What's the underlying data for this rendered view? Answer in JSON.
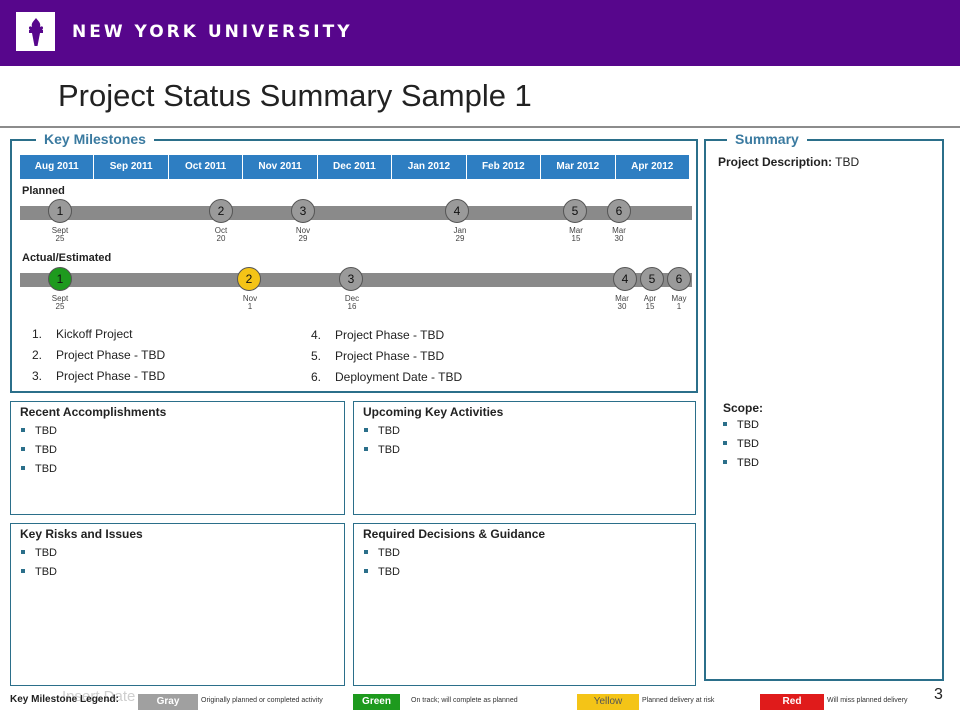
{
  "header": {
    "brand": "NEW YORK UNIVERSITY",
    "logo_icon": "torch-icon",
    "color": "#57068c"
  },
  "title": "Project Status Summary Sample 1",
  "milestones": {
    "label": "Key Milestones",
    "months": [
      "Aug 2011",
      "Sep 2011",
      "Oct 2011",
      "Nov 2011",
      "Dec 2011",
      "Jan 2012",
      "Feb 2012",
      "Mar 2012",
      "Apr 2012"
    ],
    "planned_label": "Planned",
    "actual_label": "Actual/Estimated",
    "planned": [
      {
        "n": "1",
        "date1": "Sept",
        "date2": "25",
        "status": "gray"
      },
      {
        "n": "2",
        "date1": "Oct",
        "date2": "20",
        "status": "gray"
      },
      {
        "n": "3",
        "date1": "Nov",
        "date2": "29",
        "status": "gray"
      },
      {
        "n": "4",
        "date1": "Jan",
        "date2": "29",
        "status": "gray"
      },
      {
        "n": "5",
        "date1": "Mar",
        "date2": "15",
        "status": "gray"
      },
      {
        "n": "6",
        "date1": "Mar",
        "date2": "30",
        "status": "gray"
      }
    ],
    "actual": [
      {
        "n": "1",
        "date1": "Sept",
        "date2": "25",
        "status": "green"
      },
      {
        "n": "2",
        "date1": "Nov",
        "date2": "1",
        "status": "yellow"
      },
      {
        "n": "3",
        "date1": "Dec",
        "date2": "16",
        "status": "gray"
      },
      {
        "n": "4",
        "date1": "Mar",
        "date2": "30",
        "status": "gray"
      },
      {
        "n": "5",
        "date1": "Apr",
        "date2": "15",
        "status": "gray"
      },
      {
        "n": "6",
        "date1": "May",
        "date2": "1",
        "status": "gray"
      }
    ],
    "list_left": [
      {
        "num": "1.",
        "text": "Kickoff Project"
      },
      {
        "num": "2.",
        "text": "Project Phase - TBD"
      },
      {
        "num": "3.",
        "text": "Project Phase - TBD"
      }
    ],
    "list_right": [
      {
        "num": "4.",
        "text": "Project Phase - TBD"
      },
      {
        "num": "5.",
        "text": "Project Phase - TBD"
      },
      {
        "num": "6.",
        "text": "Deployment Date - TBD"
      }
    ]
  },
  "summary": {
    "label": "Summary",
    "description_label": "Project Description:",
    "description_value": " TBD",
    "scope_label": "Scope:",
    "scope_items": [
      "TBD",
      "TBD",
      "TBD"
    ]
  },
  "boxes": {
    "accomplishments": {
      "title": "Recent Accomplishments",
      "items": [
        "TBD",
        "TBD",
        "TBD"
      ]
    },
    "upcoming": {
      "title": "Upcoming Key Activities",
      "items": [
        "TBD",
        "TBD"
      ]
    },
    "risks": {
      "title": "Key Risks and Issues",
      "items": [
        "TBD",
        "TBD"
      ]
    },
    "decisions": {
      "title": "Required Decisions & Guidance",
      "items": [
        "TBD",
        "TBD"
      ]
    }
  },
  "legend": {
    "title": "Key Milestone Legend:",
    "ghost_text": "Insert Date",
    "items": [
      {
        "name": "Gray",
        "desc": "Originally planned or completed activity",
        "color": "#a0a0a0"
      },
      {
        "name": "Green",
        "desc": "On track; will complete as planned",
        "color": "#1e9a1e"
      },
      {
        "name": "Yellow",
        "desc": "Planned delivery at risk",
        "color": "#f4c417"
      },
      {
        "name": "Red",
        "desc": "Will miss planned delivery",
        "color": "#e01b1b"
      }
    ]
  },
  "page_number": "3"
}
